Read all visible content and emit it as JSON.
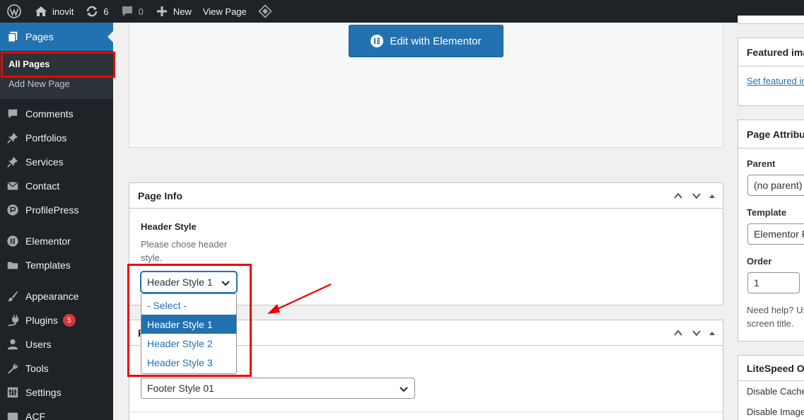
{
  "adminbar": {
    "site_name": "inovit",
    "updates_count": "6",
    "comments_count": "0",
    "new_label": "New",
    "view_page_label": "View Page"
  },
  "sidebar": {
    "pages_label": "Pages",
    "submenu": {
      "all_pages": "All Pages",
      "add_new_page": "Add New Page"
    },
    "items": [
      {
        "label": "Comments",
        "icon": "comment-icon"
      },
      {
        "label": "Portfolios",
        "icon": "pin-icon"
      },
      {
        "label": "Services",
        "icon": "pin-icon"
      },
      {
        "label": "Contact",
        "icon": "mail-icon"
      },
      {
        "label": "ProfilePress",
        "icon": "profilepress-icon"
      },
      {
        "label": "Elementor",
        "icon": "elementor-icon"
      },
      {
        "label": "Templates",
        "icon": "folder-icon"
      },
      {
        "label": "Appearance",
        "icon": "brush-icon"
      },
      {
        "label": "Plugins",
        "icon": "plugin-icon",
        "badge": "5"
      },
      {
        "label": "Users",
        "icon": "user-icon"
      },
      {
        "label": "Tools",
        "icon": "wrench-icon"
      },
      {
        "label": "Settings",
        "icon": "settings-icon"
      },
      {
        "label": "ACF",
        "icon": "acf-icon"
      }
    ]
  },
  "editor": {
    "edit_elementor_label": "Edit with Elementor"
  },
  "page_info": {
    "title": "Page Info",
    "header_style_label": "Header Style",
    "header_style_desc_line1": "Please chose header",
    "header_style_desc_line2": "style.",
    "header_style_value": "Header Style 1",
    "options": [
      "- Select -",
      "Header Style 1",
      "Header Style 2",
      "Header Style 3"
    ],
    "footer_style_value": "Footer Style 01"
  },
  "second_box": {
    "title_fragment": "F"
  },
  "right": {
    "featured_title": "Featured image",
    "featured_link": "Set featured image",
    "attributes_title": "Page Attributes",
    "parent_label": "Parent",
    "parent_value": "(no parent)",
    "template_label": "Template",
    "template_value": "Elementor Full Width",
    "order_label": "Order",
    "order_value": "1",
    "help_line1": "Need help? Use the Help tab above the",
    "help_line2": "screen title.",
    "litespeed_title": "LiteSpeed Options",
    "disable_cache": "Disable Cache",
    "disable_image": "Disable Image Lazyload"
  },
  "colors": {
    "accent": "#2271b1",
    "sidebar_bg": "#1d2327",
    "highlight_red": "#e00000"
  }
}
